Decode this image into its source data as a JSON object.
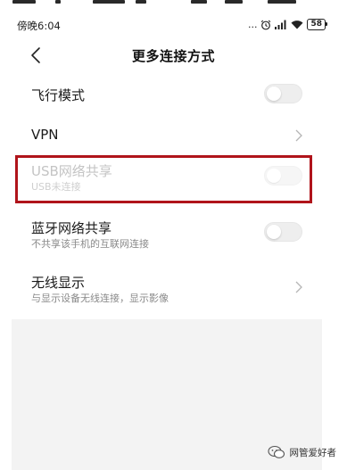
{
  "status_bar": {
    "time": "傍晚6:04",
    "icons": [
      "more-dots-icon",
      "alarm-icon",
      "signal-icon",
      "wifi-icon"
    ],
    "more": "...",
    "battery": "58"
  },
  "header": {
    "title": "更多连接方式"
  },
  "settings": {
    "airplane": {
      "title": "飞行模式",
      "toggle_on": false
    },
    "vpn": {
      "title": "VPN"
    },
    "usb_tether": {
      "title": "USB网络共享",
      "subtitle": "USB未连接",
      "toggle_on": false,
      "enabled": false
    },
    "bt_tether": {
      "title": "蓝牙网络共享",
      "subtitle": "不共享该手机的互联网连接",
      "toggle_on": false
    },
    "wireless_display": {
      "title": "无线显示",
      "subtitle": "与显示设备无线连接，显示影像"
    }
  },
  "colors": {
    "highlight_border": "#b0141b",
    "toggle_off": "#eeeeee",
    "background": "#ffffff",
    "footer_gray": "#f3f3f3"
  },
  "watermark": {
    "text": "网管爱好者",
    "icon": "wechat-logo-icon"
  }
}
